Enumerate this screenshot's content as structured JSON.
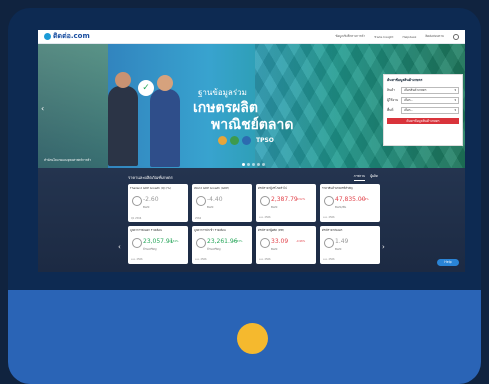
{
  "nav": {
    "logo": "ติดต่อ.com",
    "links": [
      "ข้อมูลเชิงลึกทางการค้า",
      "Trade Insight",
      "Helpdesk",
      "ติดต่อสอบถาม"
    ]
  },
  "banner": {
    "line1": "ฐานข้อมูลร่วม",
    "line2": "เกษตรผลิต",
    "line3": "พาณิชย์ตลาด",
    "brand": "TPSO",
    "caption": "สำนักนโยบายและยุทธศาสตร์การค้า"
  },
  "form": {
    "title": "ค้นหาข้อมูลสินค้าเกษตร",
    "fields": [
      {
        "label": "สินค้า",
        "value": "เลือกสินค้าเกษตร"
      },
      {
        "label": "ผู้ใช้งาน",
        "value": "เลือก..."
      },
      {
        "label": "พื้นที่",
        "value": "เลือก..."
      }
    ],
    "submit": "ค้นหาข้อมูลสินค้าเกษตร"
  },
  "section": {
    "title": "ราคาและผลิตภัณฑ์เกษตร",
    "tabs": [
      "ภาพรวม",
      "ผู้ผลิต"
    ]
  },
  "cards": [
    {
      "title": "Thailand GDP Growth (Q):(%)",
      "value": "-2.60",
      "unit": "Baht",
      "change": "",
      "date": "Q1 2566",
      "tone": "gray"
    },
    {
      "title": "World GDP Growth (GDP)",
      "value": "-4.40",
      "unit": "Baht",
      "change": "",
      "date": "2566",
      "tone": "gray"
    },
    {
      "title": "ดัชนีราคาผู้บริโภคทั่วไป",
      "value": "2,387.79",
      "unit": "Baht",
      "change": "-0.52%",
      "date": "ม.ค. 2566",
      "tone": "red"
    },
    {
      "title": "ราคาสินค้าเกษตรที่สำคัญ",
      "value": "47,835.00",
      "unit": "Baht/ตัน",
      "change": "+1.2%",
      "date": "ม.ค. 2566",
      "tone": "red"
    },
    {
      "title": "มูลค่าการส่งออก รายเดือน",
      "value": "23,057.91",
      "unit": "ล้านเหรียญ",
      "change": "+9.34%",
      "date": "ม.ค. 2566",
      "tone": "green"
    },
    {
      "title": "มูลค่าการนำเข้า รายเดือน",
      "value": "23,261.96",
      "unit": "ล้านเหรียญ",
      "change": "+7.33%",
      "date": "ม.ค. 2566",
      "tone": "green"
    },
    {
      "title": "ดัชนีราคาผู้ผลิต (PPI)",
      "value": "33.09",
      "unit": "Baht",
      "change": "-0.98%",
      "date": "ม.ค. 2566",
      "tone": "red"
    },
    {
      "title": "ดัชนีราคาส่งออก",
      "value": "1.49",
      "unit": "Baht",
      "change": "",
      "date": "ม.ค. 2566",
      "tone": "gray"
    }
  ],
  "help": "Help"
}
